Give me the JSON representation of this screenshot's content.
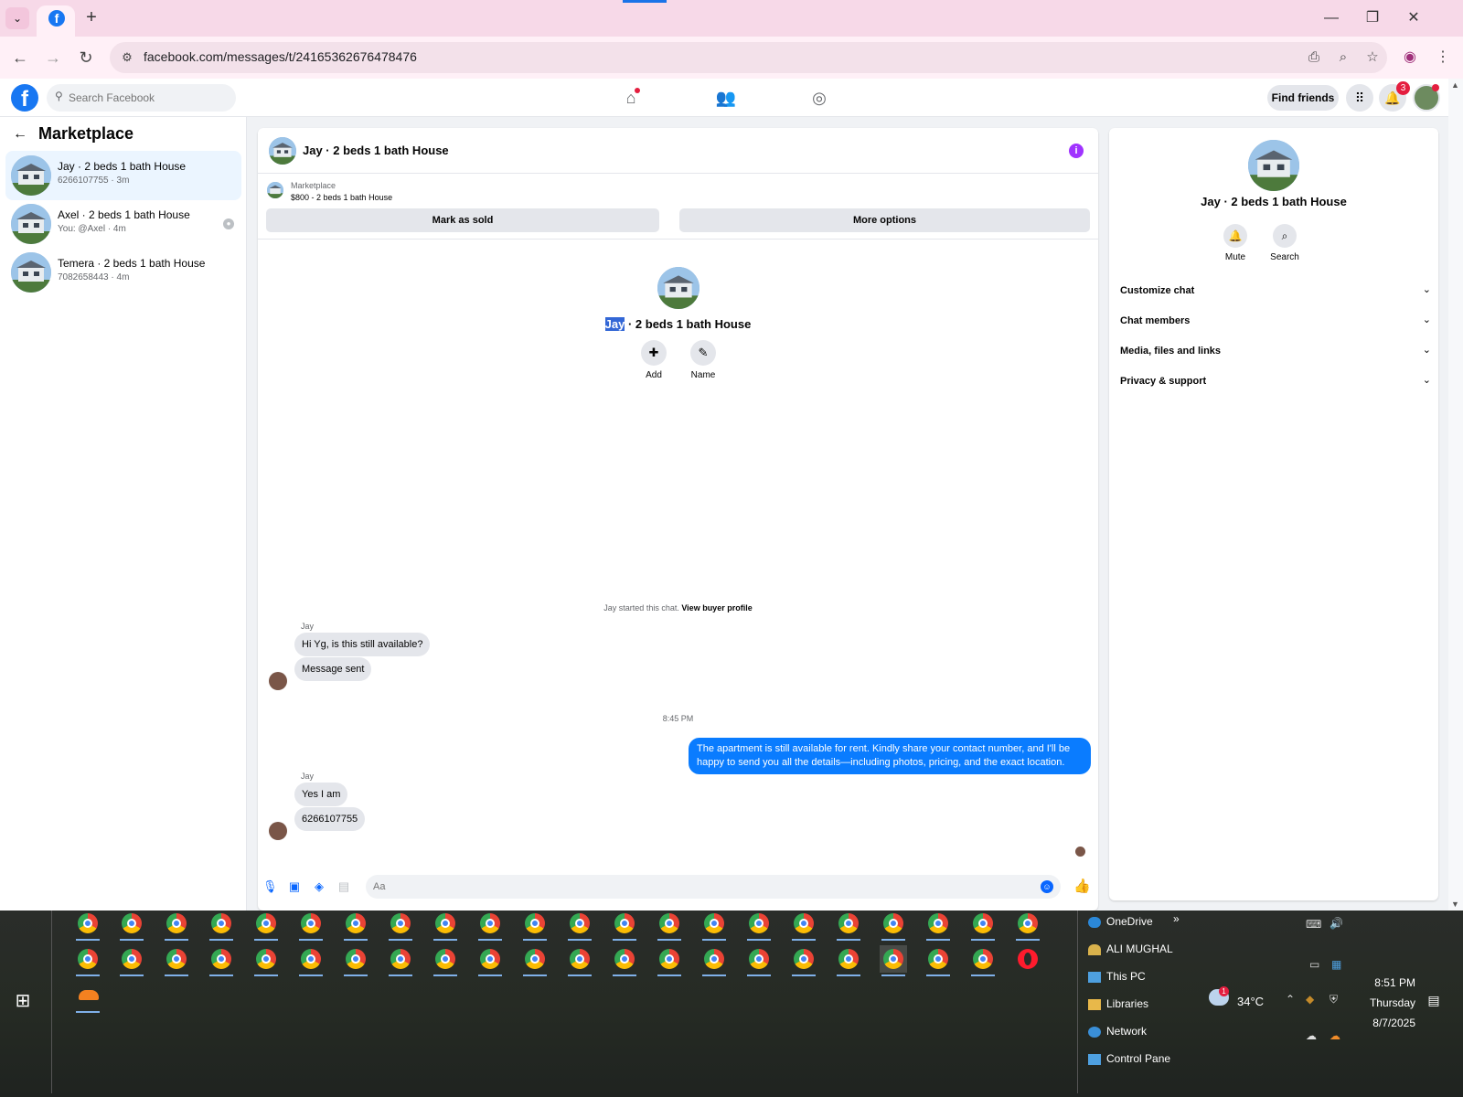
{
  "browser": {
    "url": "facebook.com/messages/t/24165362676478476",
    "tab_plus": "+"
  },
  "fb": {
    "search_placeholder": "Search Facebook",
    "find_friends": "Find friends",
    "notif_count": "3"
  },
  "left": {
    "title": "Marketplace",
    "conversations": [
      {
        "name": "Jay · 2 beds 1 bath House",
        "sub": "6266107755 · 3m"
      },
      {
        "name": "Axel · 2 beds 1 bath House",
        "sub": "You: @Axel · 4m"
      },
      {
        "name": "Temera · 2 beds 1 bath House",
        "sub": "7082658443 · 4m"
      }
    ]
  },
  "chat": {
    "header_name": "Jay · 2 beds 1 bath House",
    "marketplace_label": "Marketplace",
    "listing": "$800 - 2 beds 1 bath House",
    "mark_sold": "Mark as sold",
    "more_options": "More options",
    "title_highlight": "Jay",
    "title_rest": " · 2 beds 1 bath House",
    "add_label": "Add",
    "name_label": "Name",
    "started_text": "Jay started this chat. ",
    "buyer_profile": "View buyer profile",
    "sender1": "Jay",
    "msg1": "Hi Yg, is this still available?",
    "msg2": "Message sent",
    "time": "8:45 PM",
    "out_msg": "The apartment is still available for rent. Kindly share your contact number, and I'll be happy to send you all the details—including photos, pricing, and the exact location.",
    "sender2": "Jay",
    "msg3": "Yes I am",
    "msg4": "6266107755",
    "input_placeholder": "Aa"
  },
  "right": {
    "name": "Jay · 2 beds 1 bath House",
    "mute": "Mute",
    "search": "Search",
    "sections": [
      "Customize chat",
      "Chat members",
      "Media, files and links",
      "Privacy & support"
    ]
  },
  "taskbar": {
    "quick_access": [
      "OneDrive",
      "ALI MUGHAL",
      "This PC",
      "Libraries",
      "Network",
      "Control Pane"
    ],
    "more": "»",
    "temperature": "34°C",
    "weather_badge": "1",
    "time": "8:51 PM",
    "day": "Thursday",
    "date": "8/7/2025"
  },
  "icons": {
    "browser": [
      "tab-search-dropdown-icon",
      "facebook-favicon",
      "new-tab-icon",
      "minimize-icon",
      "restore-icon",
      "close-window-icon",
      "back-icon",
      "forward-icon",
      "reload-icon",
      "site-info-icon",
      "install-app-icon",
      "zoom-icon",
      "bookmark-star-icon",
      "profile-icon",
      "kebab-menu-icon"
    ],
    "fb": [
      "facebook-logo",
      "search-icon",
      "home-icon",
      "friends-icon",
      "groups-icon",
      "apps-grid-icon",
      "bell-icon"
    ],
    "composer": [
      "mic-icon",
      "photo-icon",
      "sticker-icon",
      "gif-icon",
      "emoji-icon",
      "like-thumb-icon"
    ]
  },
  "colors": {
    "brand": "#1877f2",
    "outgoing_bubble": "#0a7cff",
    "info_purple": "#a033ff"
  }
}
